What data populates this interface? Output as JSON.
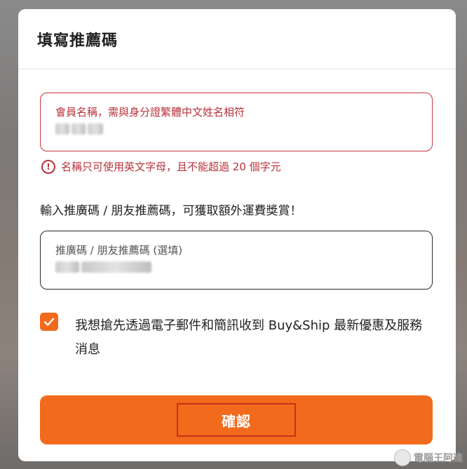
{
  "modal": {
    "title": "填寫推薦碼"
  },
  "member_name_field": {
    "label": "會員名稱，需與身分證繁體中文姓名相符",
    "value_redacted": true
  },
  "validation_error": {
    "icon": "exclamation-circle-icon",
    "text": "名稱只可使用英文字母，且不能超過 20 個字元"
  },
  "promo": {
    "text": "輸入推廣碼 / 朋友推薦碼，可獲取額外運費獎賞！"
  },
  "referral_field": {
    "label": "推廣碼 / 朋友推薦碼 (選填)",
    "value_redacted": true
  },
  "consent": {
    "checked": true,
    "text": "我想搶先透過電子郵件和簡訊收到 Buy&Ship 最新優惠及服務消息"
  },
  "confirm_button": {
    "label": "確認"
  },
  "watermark": {
    "text": "電腦王阿達"
  },
  "colors": {
    "accent": "#f26b1d",
    "error": "#b8323a",
    "text": "#222222"
  }
}
